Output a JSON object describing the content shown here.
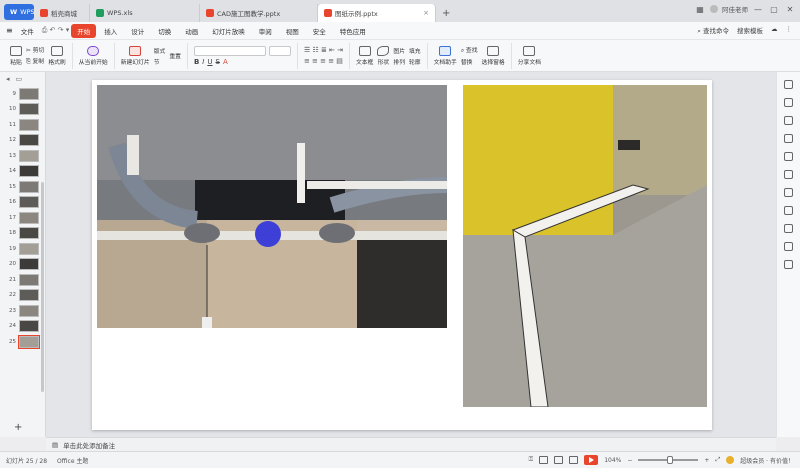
{
  "tabs": [
    {
      "label": "WPS",
      "icon": "wps-logo-icon",
      "color": "#2f6fe0"
    },
    {
      "label": "稻壳商城",
      "icon": "docer-icon",
      "color": "#e8452c"
    },
    {
      "label": "WPS.xls",
      "icon": "spreadsheet-icon",
      "color": "#1e9e5a"
    },
    {
      "label": "CAD施工图教学.pptx",
      "icon": "presentation-icon",
      "color": "#e8452c"
    },
    {
      "label": "图纸示例.pptx",
      "icon": "presentation-icon",
      "color": "#e8452c"
    }
  ],
  "window": {
    "user_label": "阿佳老师"
  },
  "menu": {
    "file": "文件",
    "items": [
      "开始",
      "插入",
      "设计",
      "切换",
      "动画",
      "幻灯片放映",
      "审阅",
      "视图",
      "安全",
      "特色应用"
    ],
    "right": [
      "查找命令",
      "搜索模板"
    ]
  },
  "toolbar": {
    "paste": "粘贴",
    "cut": "剪切",
    "copy": "复制",
    "format_painter": "格式刷",
    "from_current": "从当前开始",
    "new_slide": "新建幻灯片",
    "layout": "版式",
    "section": "节",
    "reset": "重置",
    "format_buttons": [
      "B",
      "I",
      "U",
      "S",
      "A"
    ],
    "textbox": "文本框",
    "shape": "形状",
    "picture": "图片",
    "arrange": "排列",
    "fill": "填充",
    "outline": "轮廓",
    "find": "查找",
    "replace": "替换",
    "text_tools": "文档助手",
    "select_pane": "选择窗格",
    "share": "分享文档"
  },
  "thumbnails": [
    {
      "num": "9"
    },
    {
      "num": "10"
    },
    {
      "num": "11"
    },
    {
      "num": "12"
    },
    {
      "num": "13"
    },
    {
      "num": "14"
    },
    {
      "num": "15"
    },
    {
      "num": "16"
    },
    {
      "num": "17"
    },
    {
      "num": "18"
    },
    {
      "num": "19"
    },
    {
      "num": "20"
    },
    {
      "num": "21"
    },
    {
      "num": "22"
    },
    {
      "num": "23"
    },
    {
      "num": "24"
    },
    {
      "num": "25"
    }
  ],
  "notes": {
    "placeholder": "单击此处添加备注"
  },
  "status": {
    "slide_indicator": "幻灯片 25 / 28",
    "theme": "Office 主题",
    "zoom": "104%",
    "zoom_level": 0.52,
    "right_text": "超级会员 · 有价值！"
  }
}
